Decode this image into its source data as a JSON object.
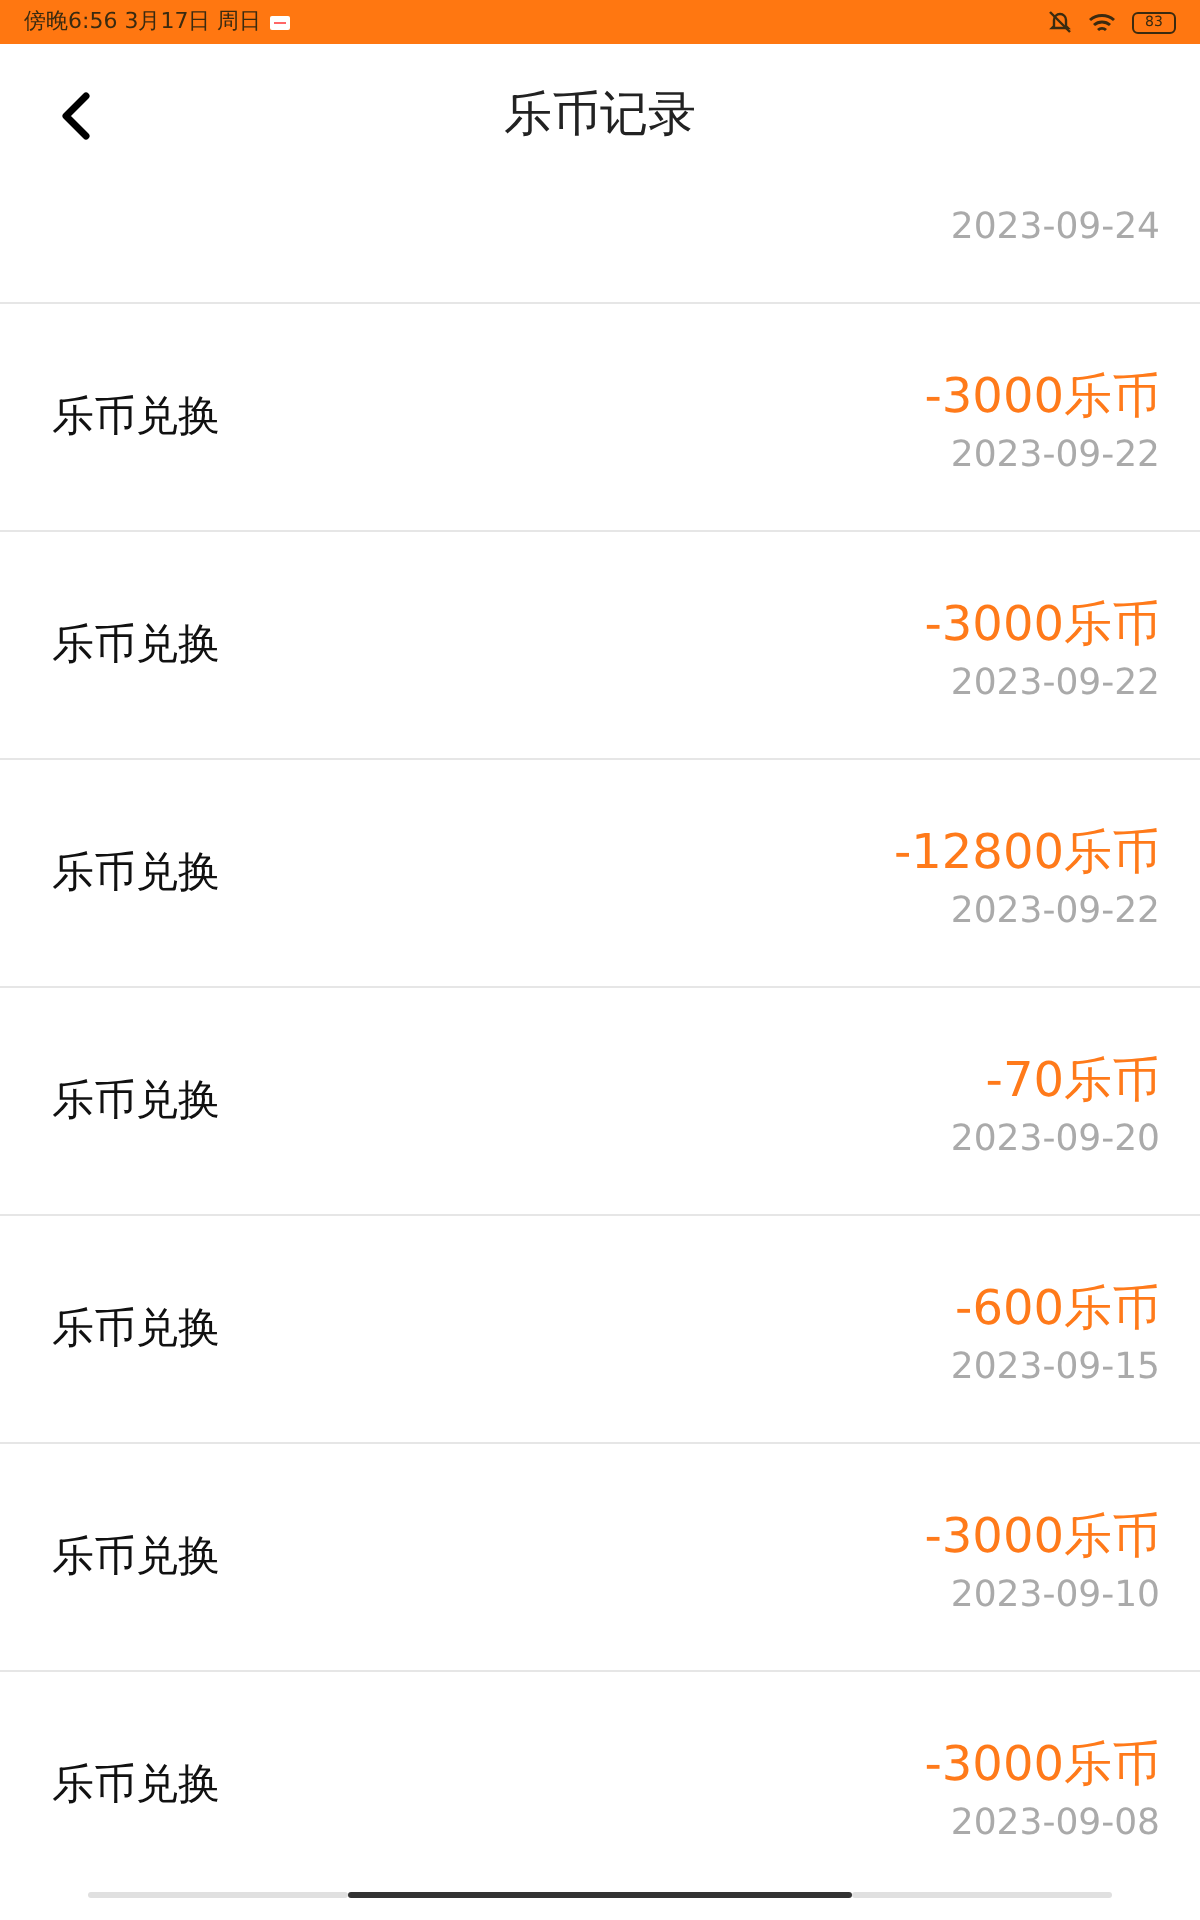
{
  "status_bar": {
    "time": "傍晚6:56 3月17日 周日",
    "battery": "83"
  },
  "header": {
    "title": "乐币记录"
  },
  "records": [
    {
      "date": "2023-09-24"
    },
    {
      "name": "乐币兑换",
      "amount": "-3000乐币",
      "date": "2023-09-22"
    },
    {
      "name": "乐币兑换",
      "amount": "-3000乐币",
      "date": "2023-09-22"
    },
    {
      "name": "乐币兑换",
      "amount": "-12800乐币",
      "date": "2023-09-22"
    },
    {
      "name": "乐币兑换",
      "amount": "-70乐币",
      "date": "2023-09-20"
    },
    {
      "name": "乐币兑换",
      "amount": "-600乐币",
      "date": "2023-09-15"
    },
    {
      "name": "乐币兑换",
      "amount": "-3000乐币",
      "date": "2023-09-10"
    },
    {
      "name": "乐币兑换",
      "amount": "-3000乐币",
      "date": "2023-09-08"
    }
  ]
}
